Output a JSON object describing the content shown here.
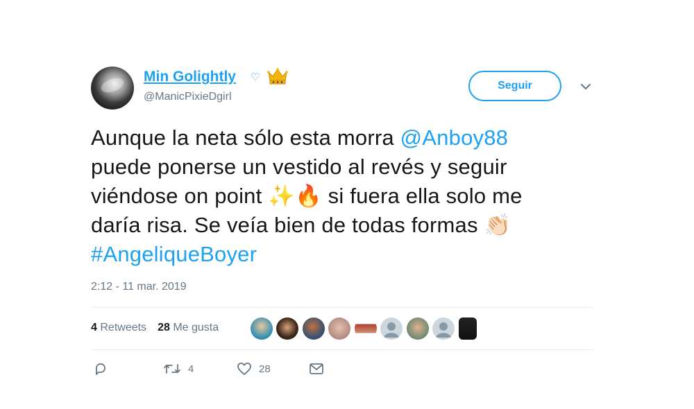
{
  "user": {
    "display_name": "Min Golightly",
    "heart_badge": "♡",
    "handle": "@ManicPixieDgirl"
  },
  "follow_button": {
    "label": "Seguir"
  },
  "tweet": {
    "line1_text": "Aunque la neta sólo esta morra ",
    "mention": "@Anboy88",
    "line2": "puede ponerse un vestido al revés y seguir",
    "line3_a": "viéndose on point ",
    "emoji_sparkles": "✨",
    "emoji_fire": "🔥",
    "line3_b": " si fuera ella solo me",
    "line4_text": "daría risa. Se veía bien de todas formas ",
    "emoji_clap": "👏🏻",
    "hashtag": "#AngeliqueBoyer"
  },
  "timestamp": "2:12 - 11 mar. 2019",
  "stats": {
    "retweets_count": "4",
    "retweets_label": "Retweets",
    "likes_count": "28",
    "likes_label": "Me gusta"
  },
  "actions": {
    "reply_icon": "reply-icon",
    "retweet_icon": "retweet-icon",
    "retweet_count": "4",
    "like_icon": "heart-icon",
    "like_count": "28",
    "dm_icon": "envelope-icon"
  },
  "colors": {
    "accent": "#1da1f2",
    "text": "#14171a",
    "secondary": "#657786",
    "divider": "#e6ecf0"
  }
}
